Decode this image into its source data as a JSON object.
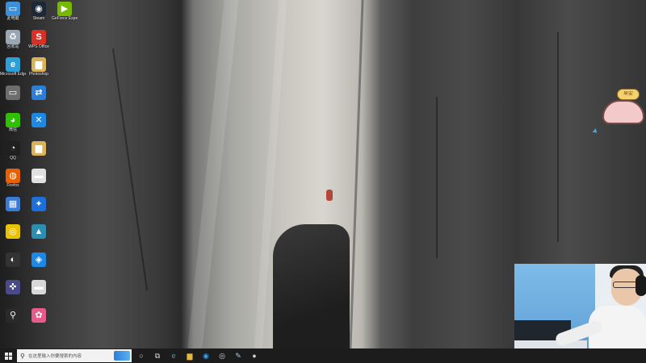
{
  "desktop": {
    "icons": [
      {
        "label": "此电脑",
        "icon": "computer-icon",
        "color": "#3d8fd8",
        "glyph": "▭"
      },
      {
        "label": "Steam",
        "icon": "steam-icon",
        "color": "#1b2838",
        "glyph": "◉"
      },
      {
        "label": "GeForce Experience",
        "icon": "geforce-icon",
        "color": "#76b900",
        "glyph": "▶"
      },
      {
        "label": "回收站",
        "icon": "recycle-bin-icon",
        "color": "#9aa6b2",
        "glyph": "♻"
      },
      {
        "label": "WPS Office",
        "icon": "wps-icon",
        "color": "#d93025",
        "glyph": "S"
      },
      {
        "label": "Microsoft Edge",
        "icon": "edge-icon",
        "color": "#2f9fd8",
        "glyph": "e"
      },
      {
        "label": "Photoshop",
        "icon": "folder-icon",
        "color": "#d8b35a",
        "glyph": "▆"
      },
      {
        "label": "",
        "icon": "app-icon",
        "color": "#6d6d6d",
        "glyph": "▭"
      },
      {
        "label": "",
        "icon": "network-icon",
        "color": "#2b7fd6",
        "glyph": "⇄"
      },
      {
        "label": "微信",
        "icon": "wechat-icon",
        "color": "#2dc100",
        "glyph": "◕"
      },
      {
        "label": "",
        "icon": "blue-app-icon",
        "color": "#1e88e5",
        "glyph": "✕"
      },
      {
        "label": "QQ",
        "icon": "qq-icon",
        "color": "#202020",
        "glyph": "◔"
      },
      {
        "label": "",
        "icon": "folder-icon",
        "color": "#d8b35a",
        "glyph": "▆"
      },
      {
        "label": "Firefox",
        "icon": "firefox-icon",
        "color": "#e66000",
        "glyph": "◍"
      },
      {
        "label": "",
        "icon": "file-icon",
        "color": "#e0e0e0",
        "glyph": "▬"
      },
      {
        "label": "",
        "icon": "app-icon",
        "color": "#3a7bd5",
        "glyph": "▦"
      },
      {
        "label": "",
        "icon": "blue-app-icon",
        "color": "#1e6fd9",
        "glyph": "✦"
      },
      {
        "label": "",
        "icon": "app-icon",
        "color": "#e8c400",
        "glyph": "◎"
      },
      {
        "label": "",
        "icon": "app-icon",
        "color": "#2a8fb0",
        "glyph": "▲"
      },
      {
        "label": "",
        "icon": "app-icon",
        "color": "#333333",
        "glyph": "◐"
      },
      {
        "label": "",
        "icon": "app-icon",
        "color": "#1e88e5",
        "glyph": "◈"
      },
      {
        "label": "",
        "icon": "app-icon",
        "color": "#4a4a8a",
        "glyph": "✜"
      },
      {
        "label": "",
        "icon": "file-icon",
        "color": "#d8d8d8",
        "glyph": "▬"
      },
      {
        "label": "",
        "icon": "app-icon",
        "color": "#2a2a2a",
        "glyph": "⚲"
      },
      {
        "label": "",
        "icon": "pink-app-icon",
        "color": "#e85a8a",
        "glyph": "✿"
      }
    ]
  },
  "sticker": {
    "bubble_text": "早安"
  },
  "taskbar": {
    "search_placeholder": "在这里输入你要搜索的内容",
    "pinned": [
      {
        "icon": "task-view-icon",
        "glyph": "○",
        "color": "#dddddd"
      },
      {
        "icon": "task-switcher-icon",
        "glyph": "⧉",
        "color": "#dddddd"
      },
      {
        "icon": "edge-icon",
        "glyph": "e",
        "color": "#2f9fd8"
      },
      {
        "icon": "file-explorer-icon",
        "glyph": "▆",
        "color": "#e8b83a"
      },
      {
        "icon": "edge-browser-icon",
        "glyph": "◉",
        "color": "#3aa0e8"
      },
      {
        "icon": "steam-icon",
        "glyph": "◎",
        "color": "#cfd8e0"
      },
      {
        "icon": "pen-icon",
        "glyph": "✎",
        "color": "#a8c8e8"
      },
      {
        "icon": "obs-icon",
        "glyph": "●",
        "color": "#cccccc"
      }
    ]
  }
}
